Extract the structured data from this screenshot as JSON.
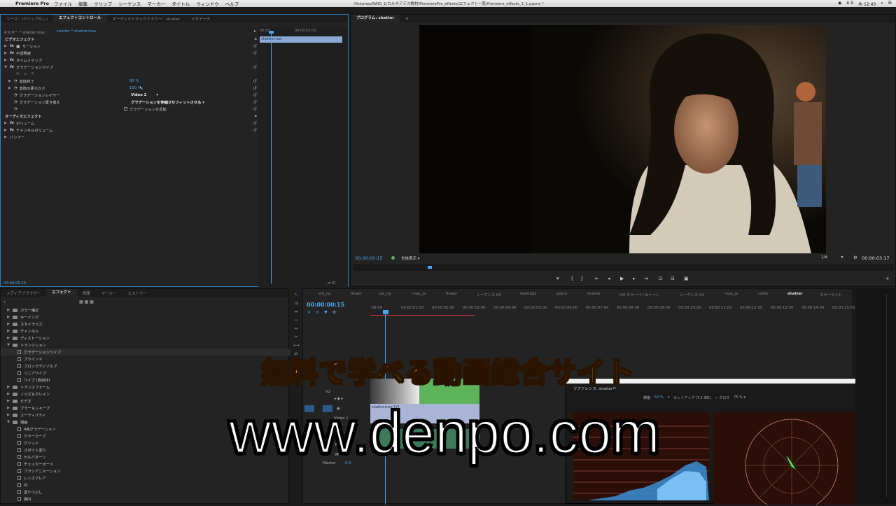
{
  "menubar": {
    "apple": "",
    "app": "Premiere Pro",
    "items": [
      "ファイル",
      "編集",
      "クリップ",
      "シーケンス",
      "マーカー",
      "タイトル",
      "ウィンドウ",
      "ヘルプ"
    ],
    "path": "/Volumes/RAID_1/カルネアデス教材/PremierePro_effects/エフェクト一覧/Premiere_effects_2_1.prproj *",
    "tray": [
      "A 9",
      "木 12:43"
    ]
  },
  "effect_controls": {
    "tabs": [
      "ソース：(クリップなし)",
      "エフェクトコントロール",
      "オーディオトラックミキサー：shatter",
      "メタデータ"
    ],
    "master_label": "マスター * shatter.mov",
    "clip_label": "shatter * shatter.mov",
    "timecode_start": "00:00",
    "timecode_end": "00:00:02:00",
    "clip_bar": "shatter.mov",
    "video_section": "ビデオエフェクト",
    "video_effects": [
      {
        "name": "モーション"
      },
      {
        "name": "不透明度"
      },
      {
        "name": "タイムリマップ"
      },
      {
        "name": "グラデーションワイプ"
      }
    ],
    "params": [
      {
        "name": "変換終了",
        "value": "60 %"
      },
      {
        "name": "変換の柔らかさ",
        "value": "100 %"
      },
      {
        "name": "グラデーションレイヤー",
        "value": "Video 2"
      },
      {
        "name": "グラデーション置き換え",
        "value": "グラデーションを伸縮させフィットさせる"
      }
    ],
    "invert_label": "グラデーションを反転",
    "audio_section": "オーディオエフェクト",
    "audio_effects": [
      "ボリューム",
      "チャンネルボリューム",
      "パンナー"
    ],
    "bottom_timecode": "00:00:00:15"
  },
  "program": {
    "title": "プログラム: shatter",
    "timecode": "00:00:00:15",
    "fit": "全体表示",
    "zoom": "1/4",
    "duration": "00:00:03:17"
  },
  "effects_panel": {
    "tabs": [
      "メディアブラウザー",
      "エフェクト",
      "情報",
      "マーカー",
      "ヒストリー"
    ],
    "tree": [
      {
        "t": "f",
        "l": "カラー補正"
      },
      {
        "t": "f",
        "l": "キーイング"
      },
      {
        "t": "f",
        "l": "スタイライズ"
      },
      {
        "t": "f",
        "l": "チャンネル"
      },
      {
        "t": "f",
        "l": "ディストーション"
      },
      {
        "t": "fo",
        "l": "トランジション"
      },
      {
        "t": "e",
        "l": "グラデーションワイプ",
        "sel": true
      },
      {
        "t": "e",
        "l": "ブラインド"
      },
      {
        "t": "e",
        "l": "ブロックディゾルブ"
      },
      {
        "t": "e",
        "l": "リニアワイプ"
      },
      {
        "t": "e",
        "l": "ワイプ (放射状)"
      },
      {
        "t": "f",
        "l": "トランスフォーム"
      },
      {
        "t": "f",
        "l": "ノイズ＆グレイン"
      },
      {
        "t": "f",
        "l": "ビデオ"
      },
      {
        "t": "f",
        "l": "ブラー＆シャープ"
      },
      {
        "t": "f",
        "l": "ユーティリティ"
      },
      {
        "t": "fo",
        "l": "描画"
      },
      {
        "t": "e",
        "l": "4色グラデーション"
      },
      {
        "t": "e",
        "l": "カラーカーブ"
      },
      {
        "t": "e",
        "l": "グリッド"
      },
      {
        "t": "e",
        "l": "スポイト塗り"
      },
      {
        "t": "e",
        "l": "セルパターン"
      },
      {
        "t": "e",
        "l": "チェッカーボード"
      },
      {
        "t": "e",
        "l": "ブラシアニメーション"
      },
      {
        "t": "e",
        "l": "レンズフレア"
      },
      {
        "t": "e",
        "l": "円"
      },
      {
        "t": "e",
        "l": "塗りつぶし"
      },
      {
        "t": "e",
        "l": "楕円"
      }
    ]
  },
  "timeline": {
    "seq_tabs": [
      "sta_ng",
      "flower",
      "sta_ng",
      "map_ja",
      "flower",
      "シーケンス 03",
      "walking2",
      "gopro",
      "shatter",
      "HD カラーバー＆トーン",
      "シーケンス 04",
      "map_ja",
      "cafe1",
      "shatter",
      "カラーマット"
    ],
    "timecode": "00:00:00:15",
    "ruler": [
      ":00:00",
      "00:00:01:00",
      "00:00:02:00",
      "00:00:03:00",
      "00:00:04:00",
      "00:00:05:00",
      "00:00:06:00",
      "00:00:07:00",
      "00:00:08:00",
      "00:00:09:00",
      "00:00:10:00",
      "00:00:11:00",
      "00:00:12:00",
      "00:00:13:00",
      "00:00:14:00",
      "00:00:15:00"
    ],
    "tracks": [
      "V2",
      "Video 1",
      "M",
      "S",
      "M",
      "S",
      "M",
      "S",
      "Master"
    ],
    "clip_label": "shatter.mov [V]",
    "master_value": "0.0"
  },
  "scopes": {
    "title": "リファレンス: shatter",
    "brightness_label": "輝度",
    "brightness": "50 %",
    "setup": "セットアップ (7.5 IRE)",
    "chroma": "クロマ",
    "pct": "75 %"
  },
  "overlay": {
    "jp": "無料で学べる動画総合サイト",
    "url": "www.denpo.com"
  },
  "colors": {
    "accent": "#4aa6ea",
    "overlay_jp": "#f2b21b",
    "clip_green": "#5db35a"
  }
}
